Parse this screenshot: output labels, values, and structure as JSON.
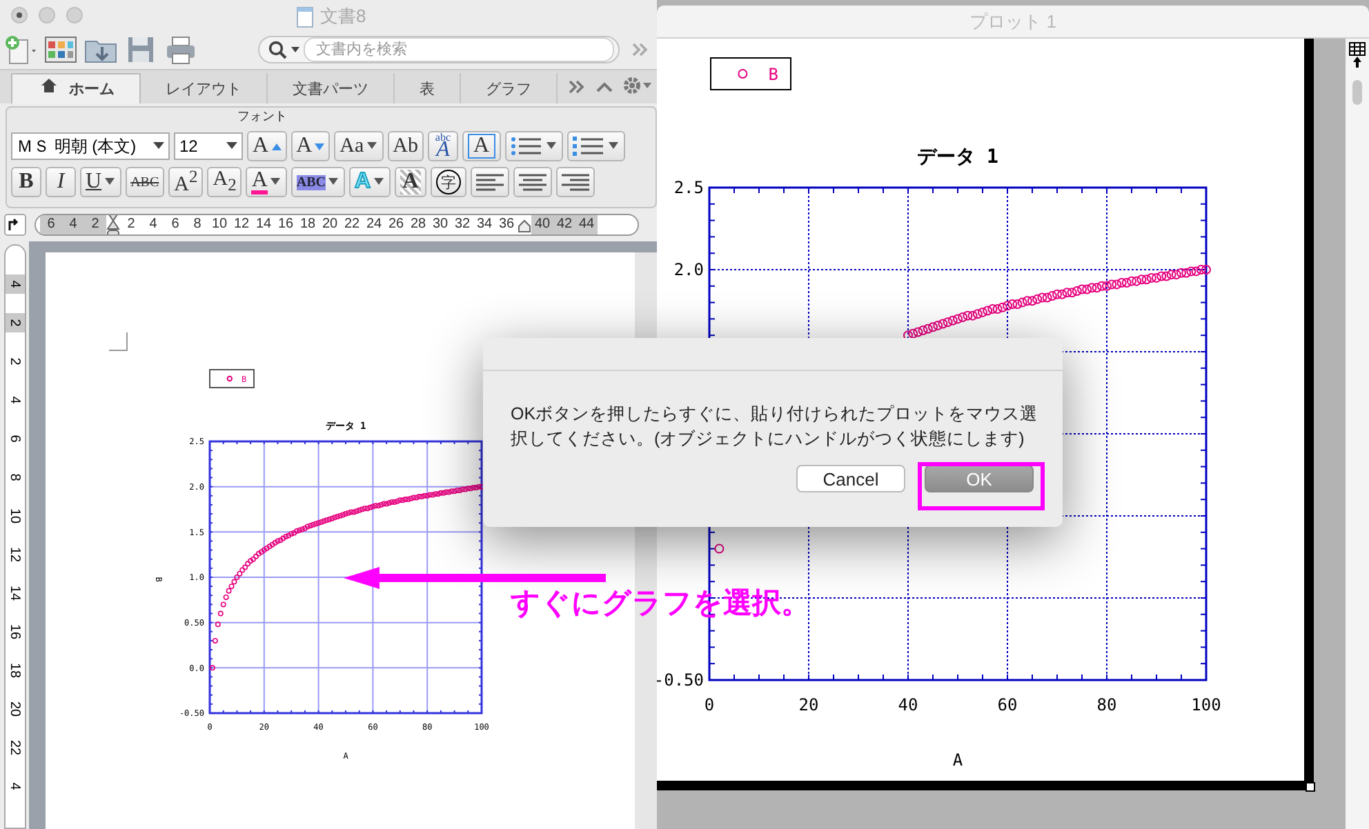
{
  "document_window": {
    "title": "文書8",
    "search": {
      "placeholder": "文書内を検索"
    },
    "tabs": [
      {
        "label": "ホーム",
        "selected": true
      },
      {
        "label": "レイアウト",
        "selected": false
      },
      {
        "label": "文書パーツ",
        "selected": false
      },
      {
        "label": "表",
        "selected": false
      },
      {
        "label": "グラフ",
        "selected": false
      }
    ],
    "ribbon": {
      "group_label": "フォント",
      "row_1": [
        {
          "kind": "font-name",
          "value": "ＭＳ 明朝 (本文)"
        },
        {
          "kind": "font-size",
          "value": "12"
        },
        {
          "kind": "grow",
          "label": "A"
        },
        {
          "kind": "shrink",
          "label": "A"
        },
        {
          "kind": "split",
          "label": "Aa"
        },
        {
          "kind": "button",
          "label": "Ab"
        },
        {
          "kind": "phonetic",
          "top": "abc",
          "label": "A"
        },
        {
          "kind": "boxed",
          "label": "A"
        },
        {
          "kind": "bullets"
        },
        {
          "kind": "numbering"
        }
      ],
      "row_2": [
        {
          "kind": "bold",
          "label": "B"
        },
        {
          "kind": "italic",
          "label": "I"
        },
        {
          "kind": "underline",
          "label": "U"
        },
        {
          "kind": "strike",
          "label": "ABC"
        },
        {
          "kind": "button",
          "label": "A$^{2}$"
        },
        {
          "kind": "button",
          "label": "A$_{2}$"
        },
        {
          "kind": "color",
          "label": "A"
        },
        {
          "kind": "highlight",
          "label": "ABC"
        },
        {
          "kind": "glow",
          "label": "A"
        },
        {
          "kind": "shade",
          "label": "A"
        },
        {
          "kind": "circled",
          "label": "字"
        },
        {
          "kind": "align-left"
        },
        {
          "kind": "align-center"
        },
        {
          "kind": "align-right"
        }
      ]
    },
    "ruler": {
      "labels": [
        "6",
        "4",
        "2",
        "2",
        "4",
        "6",
        "8",
        "10",
        "12",
        "14",
        "16",
        "18",
        "20",
        "22",
        "24",
        "26",
        "28",
        "30",
        "32",
        "34",
        "36",
        "40",
        "42",
        "44"
      ]
    },
    "vertical_ruler": {
      "labels": [
        "4",
        "2",
        "2",
        "4",
        "6",
        "8",
        "10",
        "12",
        "14",
        "16",
        "18",
        "20",
        "22",
        "4"
      ]
    },
    "page": {
      "chart_data": {
        "type": "scatter",
        "title": "データ 1",
        "xlabel": "A",
        "ylabel": "B",
        "grid": true,
        "xlim": [
          0,
          100
        ],
        "ylim": [
          -0.5,
          2.5
        ],
        "xticks": [
          {
            "value": 0,
            "label": "0"
          },
          {
            "value": 20,
            "label": "20"
          },
          {
            "value": 40,
            "label": "40"
          },
          {
            "value": 60,
            "label": "60"
          },
          {
            "value": 80,
            "label": "80"
          },
          {
            "value": 100,
            "label": "100"
          }
        ],
        "yticks": [
          {
            "value": -0.5,
            "label": "-0.50"
          },
          {
            "value": 0,
            "label": "0.0"
          },
          {
            "value": 0.5,
            "label": "0.50"
          },
          {
            "value": 1,
            "label": "1.0"
          },
          {
            "value": 1.5,
            "label": "1.5"
          },
          {
            "value": 2,
            "label": "2.0"
          },
          {
            "value": 2.5,
            "label": "2.5"
          }
        ],
        "x": [
          1,
          2,
          3,
          4,
          5,
          6,
          7,
          8,
          9,
          10,
          11,
          12,
          13,
          14,
          15,
          16,
          17,
          18,
          19,
          20,
          21,
          22,
          23,
          24,
          25,
          26,
          27,
          28,
          29,
          30,
          31,
          32,
          33,
          34,
          35,
          36,
          37,
          38,
          39,
          40,
          41,
          42,
          43,
          44,
          45,
          46,
          47,
          48,
          49,
          50,
          51,
          52,
          53,
          54,
          55,
          56,
          57,
          58,
          59,
          60,
          61,
          62,
          63,
          64,
          65,
          66,
          67,
          68,
          69,
          70,
          71,
          72,
          73,
          74,
          75,
          76,
          77,
          78,
          79,
          80,
          81,
          82,
          83,
          84,
          85,
          86,
          87,
          88,
          89,
          90,
          91,
          92,
          93,
          94,
          95,
          96,
          97,
          98,
          99,
          100
        ],
        "series": [
          {
            "name": "B",
            "color": "#e6007e",
            "values": [
              0,
              0.3,
              0.48,
              0.6,
              0.7,
              0.78,
              0.85,
              0.9,
              0.95,
              1,
              1.04,
              1.08,
              1.11,
              1.15,
              1.18,
              1.2,
              1.23,
              1.26,
              1.28,
              1.3,
              1.32,
              1.34,
              1.36,
              1.38,
              1.4,
              1.41,
              1.43,
              1.45,
              1.46,
              1.48,
              1.49,
              1.51,
              1.52,
              1.53,
              1.54,
              1.56,
              1.57,
              1.58,
              1.59,
              1.6,
              1.61,
              1.62,
              1.63,
              1.64,
              1.65,
              1.66,
              1.67,
              1.68,
              1.69,
              1.7,
              1.71,
              1.72,
              1.72,
              1.73,
              1.74,
              1.75,
              1.76,
              1.76,
              1.77,
              1.78,
              1.79,
              1.79,
              1.8,
              1.81,
              1.81,
              1.82,
              1.83,
              1.83,
              1.84,
              1.85,
              1.85,
              1.86,
              1.86,
              1.87,
              1.88,
              1.88,
              1.89,
              1.89,
              1.9,
              1.9,
              1.91,
              1.91,
              1.92,
              1.92,
              1.93,
              1.93,
              1.94,
              1.94,
              1.95,
              1.95,
              1.96,
              1.96,
              1.97,
              1.97,
              1.98,
              1.98,
              1.99,
              1.99,
              2,
              2
            ]
          }
        ]
      }
    }
  },
  "plot_window": {
    "title": "プロット 1",
    "chart_data": {
      "type": "scatter",
      "title": "データ 1",
      "xlabel": "A",
      "grid": true,
      "xlim": [
        0,
        100
      ],
      "ylim": [
        -0.5,
        2.5
      ],
      "xticks": [
        {
          "value": 0,
          "label": "0"
        },
        {
          "value": 20,
          "label": "20"
        },
        {
          "value": 40,
          "label": "40"
        },
        {
          "value": 60,
          "label": "60"
        },
        {
          "value": 80,
          "label": "80"
        },
        {
          "value": 100,
          "label": "100"
        }
      ],
      "yticks": [
        {
          "value": -0.5,
          "label": "-0.50"
        },
        {
          "value": 2,
          "label": "2.0"
        },
        {
          "value": 2.5,
          "label": "2.5"
        }
      ],
      "x": [
        2,
        40,
        41,
        42,
        43,
        44,
        45,
        46,
        47,
        48,
        49,
        50,
        51,
        52,
        53,
        54,
        55,
        56,
        57,
        58,
        59,
        60,
        61,
        62,
        63,
        64,
        65,
        66,
        67,
        68,
        69,
        70,
        71,
        72,
        73,
        74,
        75,
        76,
        77,
        78,
        79,
        80,
        81,
        82,
        83,
        84,
        85,
        86,
        87,
        88,
        89,
        90,
        91,
        92,
        93,
        94,
        95,
        96,
        97,
        98,
        99,
        100
      ],
      "series": [
        {
          "name": "B",
          "color": "#e6007e",
          "values": [
            0.3,
            1.6,
            1.61,
            1.62,
            1.63,
            1.64,
            1.65,
            1.66,
            1.67,
            1.68,
            1.69,
            1.7,
            1.71,
            1.72,
            1.72,
            1.73,
            1.74,
            1.75,
            1.76,
            1.76,
            1.77,
            1.78,
            1.79,
            1.79,
            1.8,
            1.81,
            1.81,
            1.82,
            1.83,
            1.83,
            1.84,
            1.85,
            1.85,
            1.86,
            1.86,
            1.87,
            1.88,
            1.88,
            1.89,
            1.89,
            1.9,
            1.9,
            1.91,
            1.91,
            1.92,
            1.92,
            1.93,
            1.93,
            1.94,
            1.94,
            1.95,
            1.95,
            1.96,
            1.96,
            1.97,
            1.97,
            1.98,
            1.98,
            1.99,
            1.99,
            2,
            2
          ]
        }
      ]
    }
  },
  "dialog": {
    "message": "OKボタンを押したらすぐに、貼り付けられたプロットをマウス選択してください。(オブジェクトにハンドルがつく状態にします)",
    "buttons": [
      {
        "label": "Cancel",
        "default": false
      },
      {
        "label": "OK",
        "default": true
      }
    ]
  },
  "annotation": {
    "text": "すぐにグラフを選択。"
  }
}
